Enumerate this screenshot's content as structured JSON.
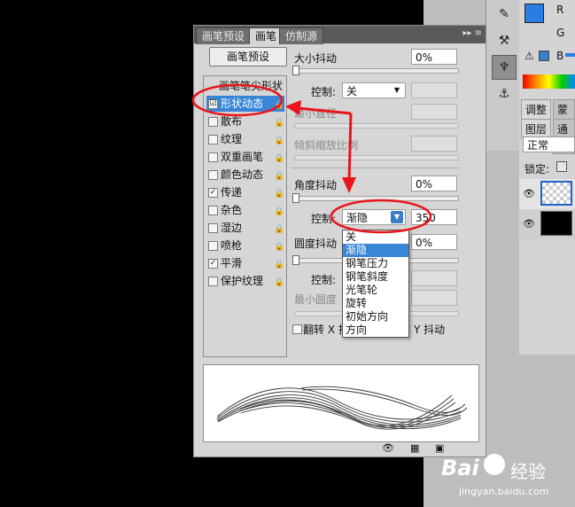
{
  "tabs": {
    "brush_presets": "画笔预设",
    "brush": "画笔",
    "clone_source": "仿制源",
    "menu": "▸▸ ≡"
  },
  "presets_button": "画笔预设",
  "options": {
    "tip_shape": "画笔笔尖形状",
    "items": [
      {
        "label": "形状动态",
        "checked": "☑"
      },
      {
        "label": "散布",
        "checked": ""
      },
      {
        "label": "纹理",
        "checked": ""
      },
      {
        "label": "双重画笔",
        "checked": ""
      },
      {
        "label": "颜色动态",
        "checked": ""
      },
      {
        "label": "传递",
        "checked": "✓"
      },
      {
        "label": "杂色",
        "checked": ""
      },
      {
        "label": "湿边",
        "checked": ""
      },
      {
        "label": "喷枪",
        "checked": ""
      },
      {
        "label": "平滑",
        "checked": "✓"
      },
      {
        "label": "保护纹理",
        "checked": ""
      }
    ]
  },
  "settings": {
    "size_jitter_label": "大小抖动",
    "size_jitter_value": "0%",
    "control_label": "控制:",
    "control_value_1": "关",
    "min_diameter_label": "最小直径",
    "tilt_scale_label": "倾斜缩放比例",
    "angle_jitter_label": "角度抖动",
    "angle_jitter_value": "0%",
    "control_value_2": "渐隐",
    "fade_steps": "350",
    "roundness_jitter_label": "圆度抖动",
    "roundness_jitter_value": "0%",
    "min_roundness_label": "最小圆度",
    "flip_x_label": "翻转 X 抖",
    "flip_y_label": "Y 抖动"
  },
  "dropdown_options": [
    "关",
    "渐隐",
    "钢笔压力",
    "钢笔斜度",
    "光笔轮",
    "旋转",
    "初始方向",
    "方向"
  ],
  "color_panel": {
    "r": "R",
    "g": "G",
    "b": "B",
    "warning": "⚠"
  },
  "layers_panel": {
    "tab_adjust": "调整",
    "tab_mask": "蒙版",
    "tab_layers": "图层",
    "tab_channels": "通道",
    "blend_mode": "正常",
    "lock_label": "锁定:"
  },
  "watermark": {
    "brand": "Bai",
    "brand_cn": "经验",
    "url": "jingyan.baidu.com"
  },
  "colors": {
    "accent_red": "#e8151b",
    "highlight_blue": "#3a86d6",
    "foreground": "#2b7de6"
  }
}
